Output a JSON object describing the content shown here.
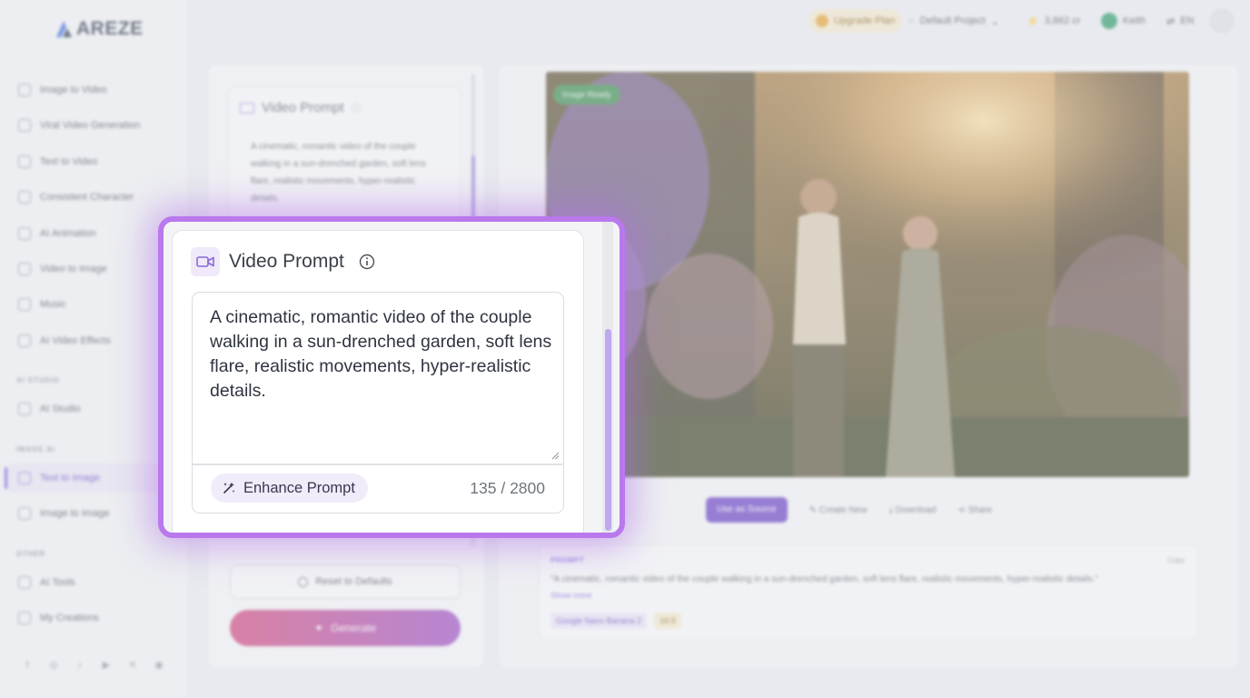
{
  "app": {
    "brand": "AREZE"
  },
  "sidebar": {
    "items": [
      {
        "label": "Image to Video"
      },
      {
        "label": "Viral Video Generation"
      },
      {
        "label": "Text to Video"
      },
      {
        "label": "Consistent Character"
      },
      {
        "label": "AI Animation"
      },
      {
        "label": "Video to Image"
      },
      {
        "label": "Music"
      },
      {
        "label": "AI Video Effects"
      }
    ],
    "section_studio": "AI STUDIO",
    "studio_items": [
      {
        "label": "AI Studio"
      }
    ],
    "section_image": "IMAGE AI",
    "image_items": [
      {
        "label": "Text to Image",
        "active": true
      },
      {
        "label": "Image to Image"
      }
    ],
    "section_other": "OTHER",
    "other_items": [
      {
        "label": "AI Tools"
      },
      {
        "label": "My Creations"
      }
    ],
    "social_icons": [
      "facebook-icon",
      "instagram-icon",
      "tiktok-icon",
      "youtube-icon",
      "x-icon",
      "discord-icon"
    ]
  },
  "topbar": {
    "upgrade_label": "Upgrade Plan",
    "project_label": "Default Project",
    "credits_label": "3,862 cr",
    "user_label": "Keith",
    "lang_label": "EN"
  },
  "left_panel": {
    "prompt_title": "Video Prompt",
    "prompt_text": "A cinematic, romantic video of the couple walking in a sun-drenched garden, soft lens flare, realistic movements, hyper-realistic details.",
    "reset_label": "Reset to Defaults",
    "generate_label": "Generate"
  },
  "preview": {
    "tag_label": "Image Ready",
    "actions": {
      "use_as_source": "Use as Source",
      "create_new": "Create New",
      "download": "Download",
      "share": "Share"
    },
    "prompt_label": "PROMPT",
    "copy_label": "Copy",
    "prompt_text": "\"A cinematic, romantic video of the couple walking in a sun-drenched garden, soft lens flare, realistic movements, hyper-realistic details.\"",
    "show_more": "Show more",
    "model_chip": "Google Nano Banana 2",
    "ratio_chip": "16:9"
  },
  "zoom": {
    "title": "Video Prompt",
    "prompt_text": "A cinematic, romantic video of the couple walking in a sun-drenched garden, soft lens flare, realistic movements, hyper-realistic details.",
    "enhance_label": "Enhance Prompt",
    "char_count": "135 / 2800",
    "scroll_fraction": 0.35
  },
  "colors": {
    "accent": "#7c5ce0",
    "glow": "#b978ec",
    "generate_start": "#d2457a",
    "generate_end": "#9d4cc4"
  }
}
